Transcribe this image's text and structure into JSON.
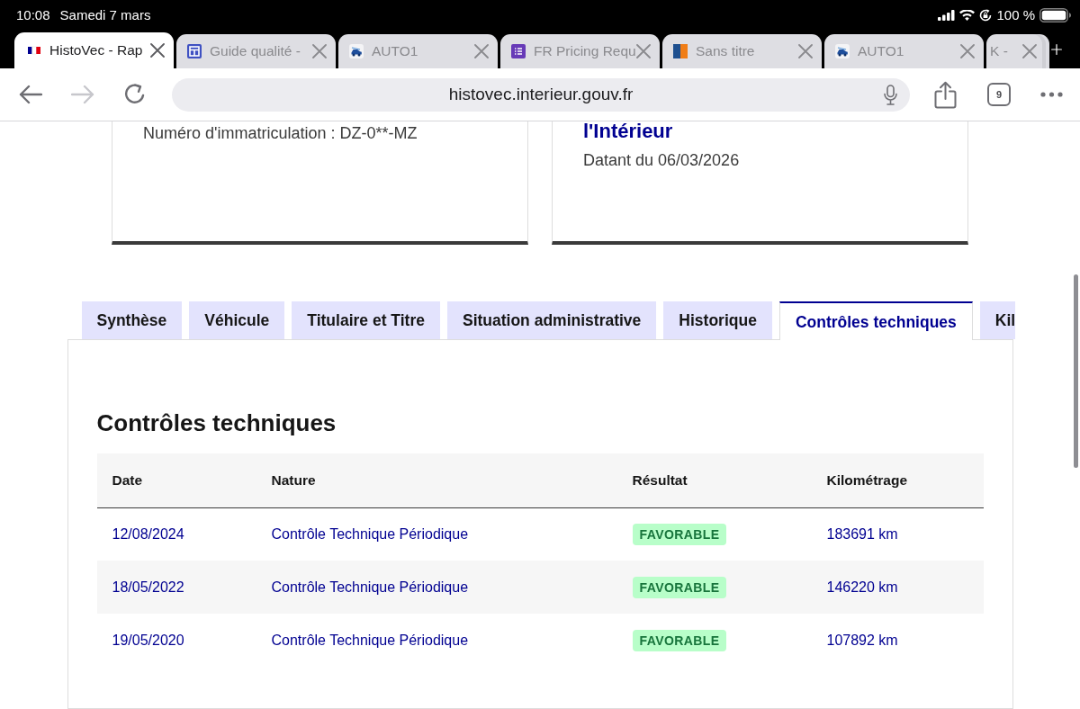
{
  "status_bar": {
    "time": "10:08",
    "date": "Samedi 7 mars",
    "battery": "100 %"
  },
  "browser_tabs": [
    {
      "kind": "flag",
      "title": "HistoVec - Rap",
      "selected": true
    },
    {
      "kind": "layout",
      "title": "Guide qualité -",
      "selected": false
    },
    {
      "kind": "car",
      "title": "AUTO1",
      "selected": false
    },
    {
      "kind": "list",
      "title": "FR Pricing Requ",
      "selected": false
    },
    {
      "kind": "split",
      "title": "Sans titre",
      "selected": false
    },
    {
      "kind": "car",
      "title": "AUTO1",
      "selected": false
    },
    {
      "kind": "stack",
      "title": "K -",
      "selected": false
    }
  ],
  "toolbar": {
    "nav": [
      {
        "kind": "back",
        "disabled": false
      },
      {
        "kind": "forward",
        "disabled": true
      },
      {
        "kind": "reload",
        "disabled": false
      }
    ],
    "address": "histovec.interieur.gouv.fr",
    "tab_count": "9"
  },
  "page": {
    "cards": [
      {
        "text": "Numéro d'immatriculation : DZ-0**-MZ"
      },
      {
        "title": "l'Intérieur",
        "text": "Datant du 06/03/2026"
      }
    ],
    "tabs": [
      {
        "label": "Synthèse",
        "selected": false
      },
      {
        "label": "Véhicule",
        "selected": false
      },
      {
        "label": "Titulaire et Titre",
        "selected": false
      },
      {
        "label": "Situation administrative",
        "selected": false
      },
      {
        "label": "Historique",
        "selected": false
      },
      {
        "label": "Contrôles techniques",
        "selected": true
      },
      {
        "label": "Kil",
        "selected": false
      }
    ],
    "section": {
      "heading": "Contrôles techniques",
      "columns": [
        "Date",
        "Nature",
        "Résultat",
        "Kilométrage"
      ],
      "rows": [
        {
          "date": "12/08/2024",
          "nature": "Contrôle Technique Périodique",
          "result": "FAVORABLE",
          "mileage": "183691 km"
        },
        {
          "date": "18/05/2022",
          "nature": "Contrôle Technique Périodique",
          "result": "FAVORABLE",
          "mileage": "146220 km"
        },
        {
          "date": "19/05/2020",
          "nature": "Contrôle Technique Périodique",
          "result": "FAVORABLE",
          "mileage": "107892 km"
        }
      ]
    }
  }
}
